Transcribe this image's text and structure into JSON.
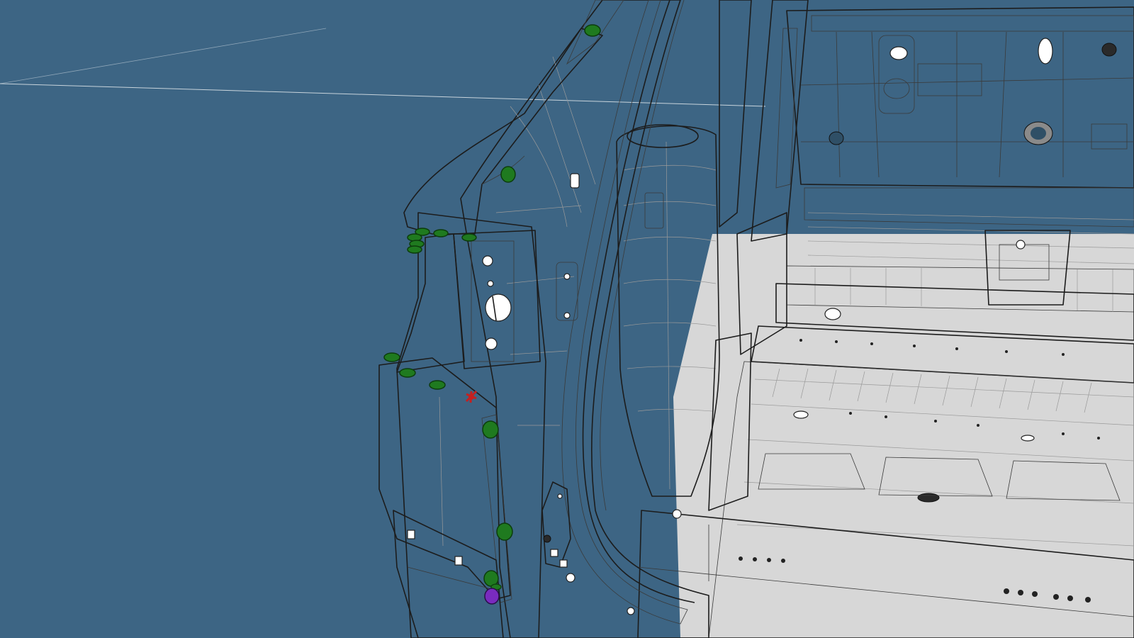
{
  "viewport": {
    "background_color": "#3d6584",
    "surface_color": "#e2e2e2",
    "shaded_panel_color": "#6d6d6d",
    "edge_color": "#1c1c1c"
  },
  "annotation_markers": {
    "green_marker_color": "#1f7a1f",
    "green_marker_count": 15,
    "red_marker_color": "#c42020",
    "red_marker_count": 1,
    "purple_marker_color": "#7a2bbf",
    "purple_marker_count": 1
  }
}
